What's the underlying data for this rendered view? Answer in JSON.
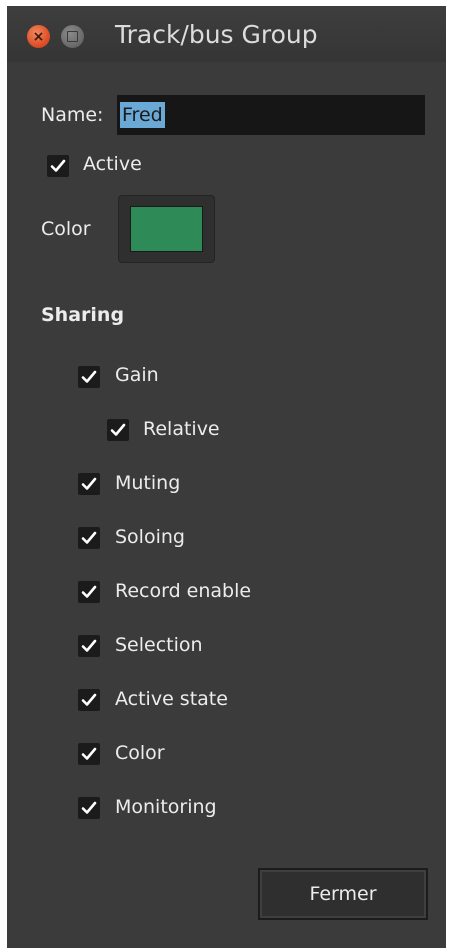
{
  "window": {
    "title": "Track/bus Group",
    "close_glyph": "×",
    "close_icon": "close-icon",
    "minimize_icon": "window-square-icon"
  },
  "form": {
    "name_label": "Name:",
    "name_value": "Fred",
    "active_label": "Active",
    "active_checked": true,
    "color_label": "Color",
    "color_value": "#2e8a56"
  },
  "sharing": {
    "heading": "Sharing",
    "items": [
      {
        "label": "Gain",
        "checked": true
      },
      {
        "label": "Relative",
        "checked": true
      },
      {
        "label": "Muting",
        "checked": true
      },
      {
        "label": "Soloing",
        "checked": true
      },
      {
        "label": "Record enable",
        "checked": true
      },
      {
        "label": "Selection",
        "checked": true
      },
      {
        "label": "Active state",
        "checked": true
      },
      {
        "label": "Color",
        "checked": true
      },
      {
        "label": "Monitoring",
        "checked": true
      }
    ]
  },
  "footer": {
    "close_button_label": "Fermer"
  },
  "colors": {
    "window_bg": "#3b3b3b",
    "selection_highlight": "#6aa9d6",
    "close_button": "#e0502a"
  }
}
